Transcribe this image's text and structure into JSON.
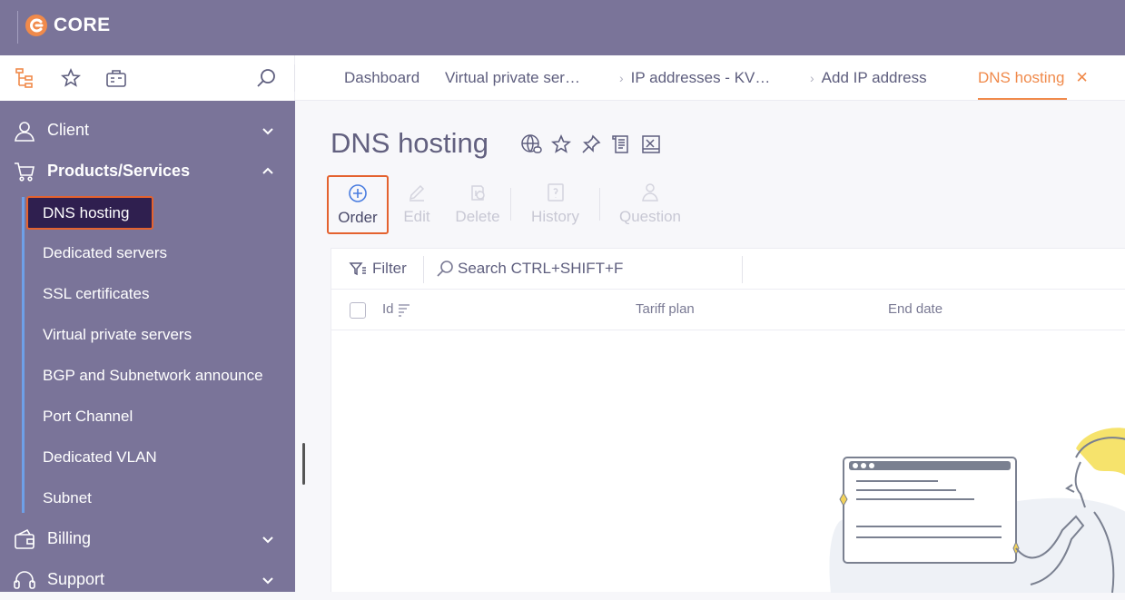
{
  "brand": {
    "name": "CORE",
    "logo_color": "#f08a4b"
  },
  "colors": {
    "sidebar_bg": "#7a7499",
    "accent": "#f08a4b",
    "active_item_bg": "#2f1f4f",
    "highlight_border": "#e4622f",
    "submenu_rail": "#6ea0e8"
  },
  "toolbar_icons": [
    "sitemap-icon",
    "star-icon",
    "briefcase-icon",
    "search-icon"
  ],
  "tabs": [
    {
      "label": "Dashboard",
      "chevron": false,
      "active": false
    },
    {
      "label": "Virtual private ser…",
      "chevron": false,
      "active": false
    },
    {
      "label": "IP addresses - KV…",
      "chevron": true,
      "active": false
    },
    {
      "label": "Add IP address",
      "chevron": true,
      "active": false
    },
    {
      "label": "DNS hosting",
      "chevron": false,
      "active": true,
      "close": "✕"
    }
  ],
  "sidebar": {
    "sections": [
      {
        "label": "Client",
        "icon": "user-icon",
        "expanded": false
      },
      {
        "label": "Products/Services",
        "icon": "cart-icon",
        "expanded": true
      },
      {
        "label": "Billing",
        "icon": "wallet-icon",
        "expanded": false
      },
      {
        "label": "Support",
        "icon": "headset-icon",
        "expanded": false
      }
    ],
    "products_items": [
      "DNS hosting",
      "Dedicated servers",
      "SSL certificates",
      "Virtual private servers",
      "BGP and Subnetwork announce",
      "Port Channel",
      "Dedicated VLAN",
      "Subnet"
    ],
    "active_item": "DNS hosting"
  },
  "page": {
    "title": "DNS hosting",
    "title_icons": [
      "globe-link-icon",
      "star-icon",
      "pin-icon",
      "scroll-icon",
      "spreadsheet-icon"
    ]
  },
  "actions": [
    {
      "label": "Order",
      "icon": "plus-circle-icon",
      "enabled": true
    },
    {
      "label": "Edit",
      "icon": "pencil-icon",
      "enabled": false
    },
    {
      "label": "Delete",
      "icon": "trash-icon",
      "enabled": false
    },
    {
      "label": "History",
      "icon": "history-icon",
      "enabled": false
    },
    {
      "label": "Question",
      "icon": "question-user-icon",
      "enabled": false
    }
  ],
  "table": {
    "filter_label": "Filter",
    "search_placeholder": "Search CTRL+SHIFT+F",
    "columns": [
      "Id",
      "Tariff plan",
      "End date"
    ]
  }
}
